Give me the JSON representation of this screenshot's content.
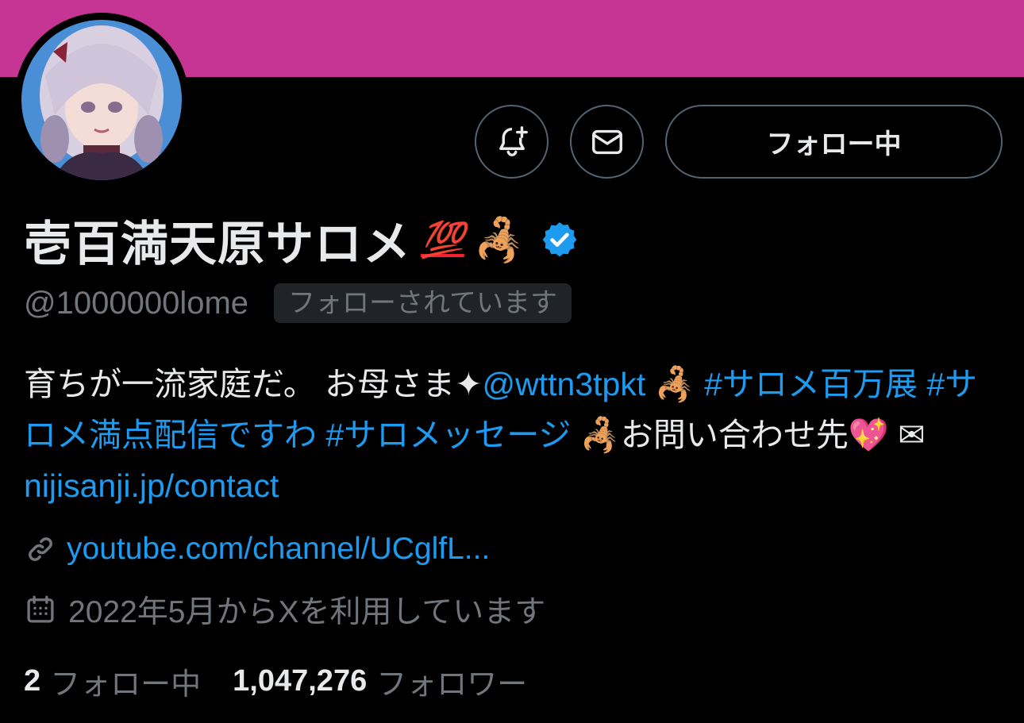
{
  "banner": {
    "color": "#c73594"
  },
  "actions": {
    "notify_icon": "bell-plus-icon",
    "message_icon": "envelope-icon",
    "follow_label": "フォロー中"
  },
  "profile": {
    "display_name": "壱百満天原サロメ",
    "name_emoji_1": "💯",
    "name_emoji_2": "🦂",
    "verified_color": "#1d9bf0",
    "handle": "@1000000lome",
    "follows_you": "フォローされています"
  },
  "bio": {
    "text_1": "育ちが一流家庭だ。 お母さま",
    "sparkle": "✦",
    "mention": "@wttn3tpkt",
    "scorpion": "🦂",
    "hashtag_1": "#サロメ百万展",
    "hashtag_2": "#サロメ満点配信ですわ",
    "hashtag_3": "#サロメッセージ",
    "text_2": "お問い合わせ先",
    "heart": "💖",
    "envelope": "✉",
    "contact_link": "nijisanji.jp/contact"
  },
  "meta": {
    "website": "youtube.com/channel/UCglfL...",
    "joined": "2022年5月からXを利用しています"
  },
  "stats": {
    "following_count": "2",
    "following_label": "フォロー中",
    "followers_count": "1,047,276",
    "followers_label": "フォロワー"
  },
  "colors": {
    "background": "#000000",
    "text_primary": "#e7e9ea",
    "text_secondary": "#71767b",
    "link": "#1d9bf0",
    "border": "#536471"
  }
}
